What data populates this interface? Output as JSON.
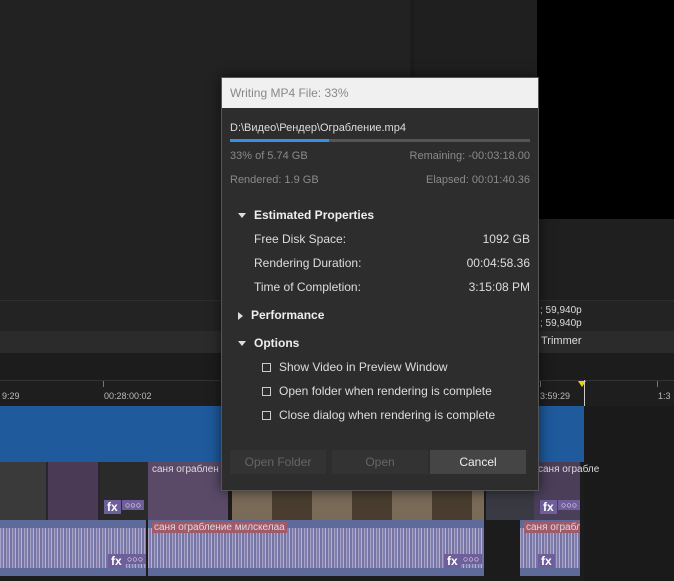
{
  "dialog": {
    "title": "Writing MP4 File: 33%",
    "file_path": "D:\\Видео\\Рендер\\Ограбление.mp4",
    "progress": 0.33,
    "progress_text": "33% of 5.74 GB",
    "remaining": "Remaining: -00:03:18.00",
    "rendered": "Rendered: 1.9 GB",
    "elapsed": "Elapsed: 00:01:40.36",
    "sections": {
      "estimated": "Estimated Properties",
      "performance": "Performance",
      "options": "Options"
    },
    "properties": [
      {
        "label": "Free Disk Space:",
        "value": "1092 GB"
      },
      {
        "label": "Rendering Duration:",
        "value": "00:04:58.36"
      },
      {
        "label": "Time of Completion:",
        "value": "3:15:08 PM"
      }
    ],
    "options": [
      {
        "label": "Show Video in Preview Window",
        "checked": false
      },
      {
        "label": "Open folder when rendering is complete",
        "checked": false
      },
      {
        "label": "Close dialog when rendering is complete",
        "checked": false
      }
    ],
    "buttons": {
      "open_folder": "Open Folder",
      "open": "Open",
      "cancel": "Cancel"
    }
  },
  "background": {
    "fps_line_1": "; 59,940p",
    "fps_line_2": "; 59,940p",
    "trimmer_label": "Trimmer",
    "ruler": {
      "left_label": "9:29",
      "mid_label": "00:28:00:02",
      "right_label": "3:59:29",
      "far_right_label": "1:3"
    },
    "clips": {
      "video_label": "саня ограблен",
      "video_label_right": "саня ограбле",
      "audio_label": "саня ограбление милскелаа",
      "audio_label_right": "саня ограбле",
      "fx": "fx",
      "more": "○○○"
    }
  }
}
